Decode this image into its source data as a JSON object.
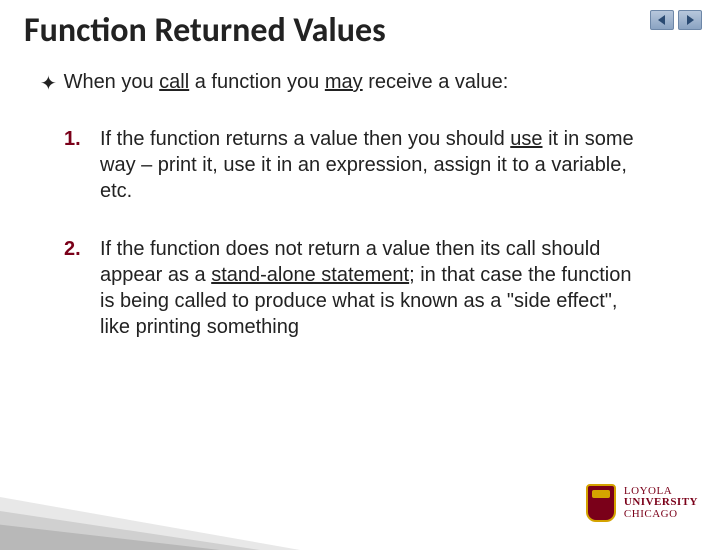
{
  "title": "Function Returned Values",
  "intro_bullet": "✦",
  "intro_pre": "When you ",
  "intro_u1": "call",
  "intro_mid": " a function you ",
  "intro_u2": "may",
  "intro_post": " receive a value:",
  "items": [
    {
      "num": "1.",
      "pre": "If the function returns a value then you should ",
      "u1": "use",
      "post": " it in some way – print it, use it in an expression, assign it to a variable, etc."
    },
    {
      "num": "2.",
      "pre": "If the function does not return a value then its call should appear as a ",
      "u1": "stand-alone statement",
      "post": "; in that case the function is being called to produce what is known as a \"side effect\", like printing something"
    }
  ],
  "logo": {
    "l1": "LOYOLA",
    "l2": "UNIVERSITY",
    "l3": "CHICAGO"
  },
  "nav": {
    "prev": "prev",
    "next": "next"
  }
}
